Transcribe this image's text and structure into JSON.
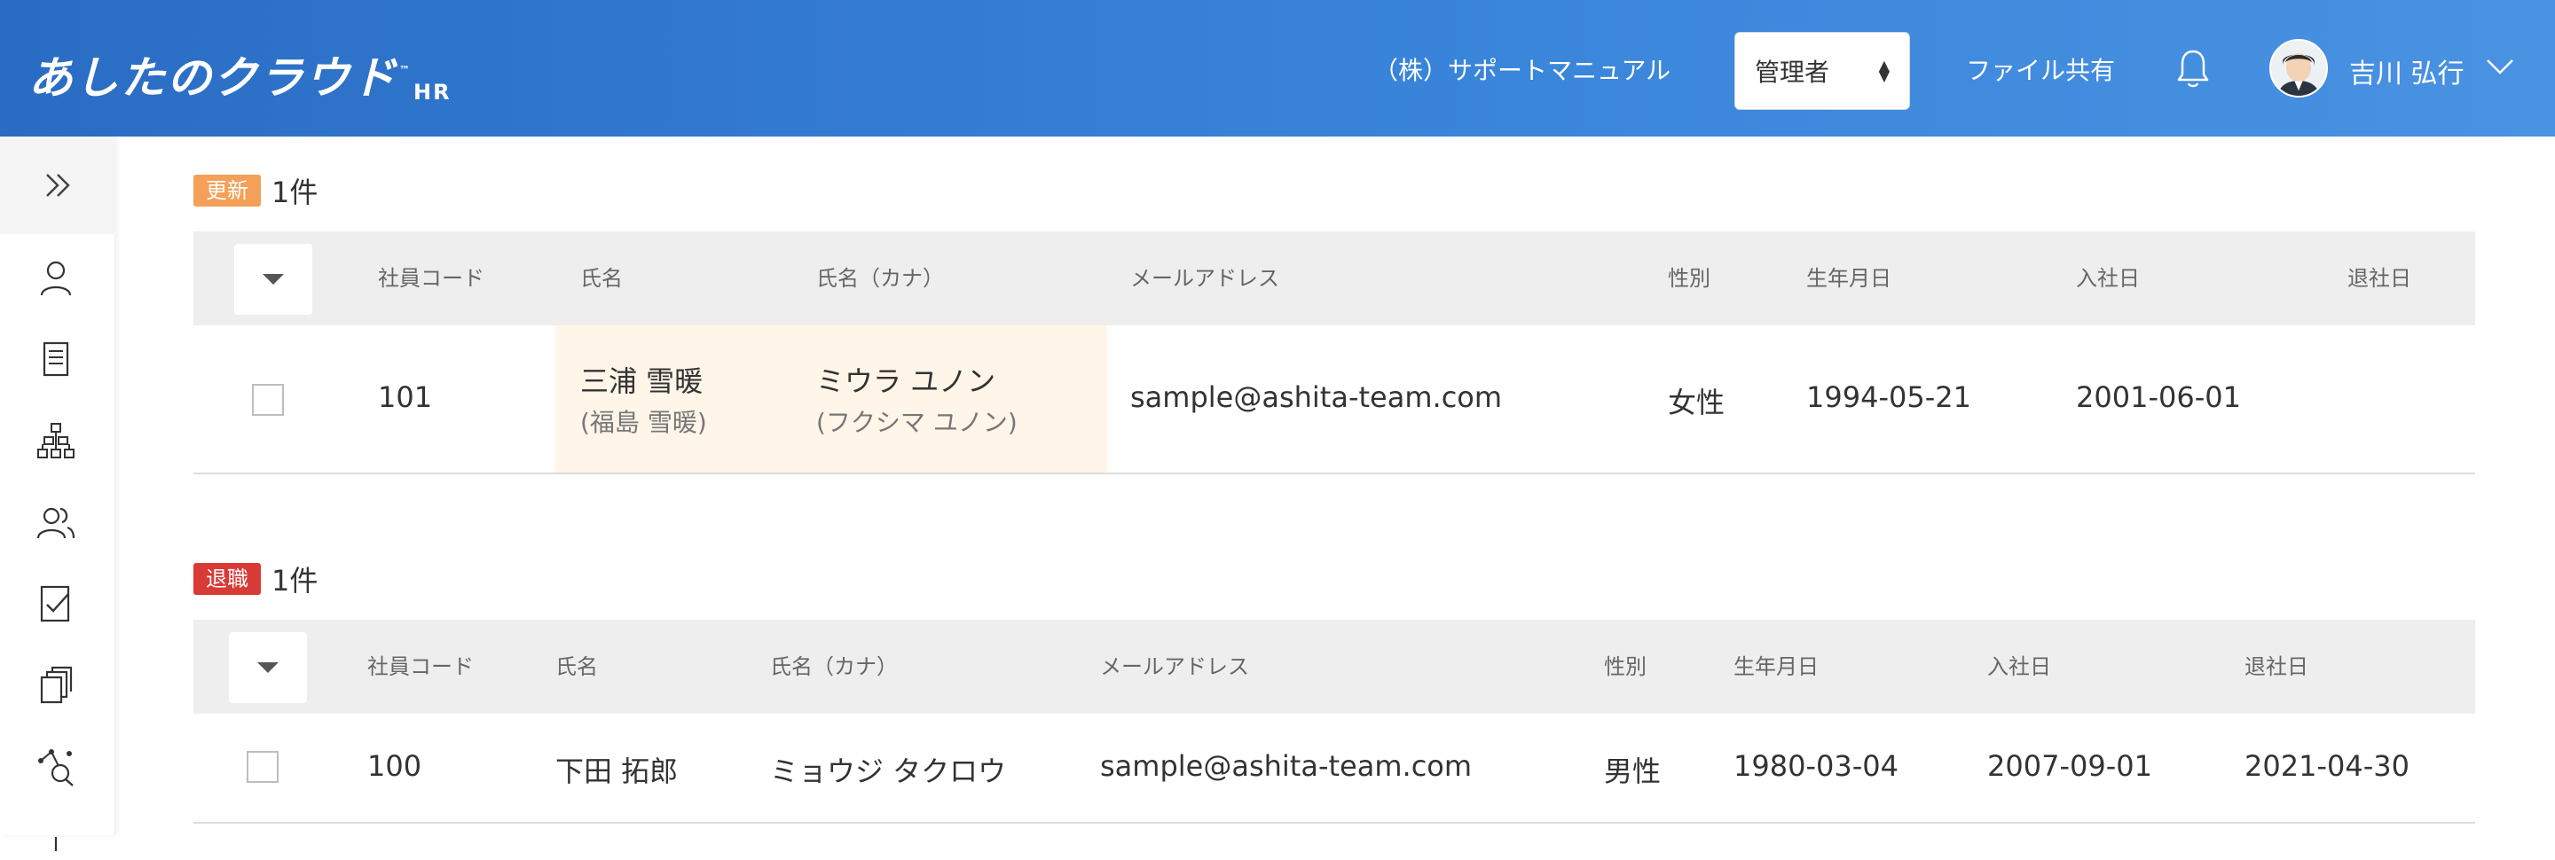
{
  "header": {
    "logo_text": "あしたのクラウド",
    "logo_tm": "™",
    "logo_suffix": "HR",
    "company": "（株）サポートマニュアル",
    "role_select": {
      "value": "管理者"
    },
    "file_share": "ファイル共有",
    "user_name": "吉川 弘行"
  },
  "sidebar": {
    "items": [
      {
        "icon": "person-icon"
      },
      {
        "icon": "document-icon"
      },
      {
        "icon": "org-chart-icon"
      },
      {
        "icon": "group-icon"
      },
      {
        "icon": "checklist-icon"
      },
      {
        "icon": "copy-icon"
      },
      {
        "icon": "analytics-search-icon"
      }
    ]
  },
  "colors": {
    "header_start": "#2a6cc4",
    "header_end": "#4a92e2",
    "update_badge": "#f4a058",
    "retire_badge": "#d83a36",
    "highlight": "#fff5e8"
  },
  "sections": {
    "update": {
      "badge": "更新",
      "count": "1件",
      "columns": [
        "社員コード",
        "氏名",
        "氏名（カナ）",
        "メールアドレス",
        "性別",
        "生年月日",
        "入社日",
        "退社日"
      ],
      "rows": [
        {
          "code": "101",
          "name": "三浦 雪暖",
          "name_prev": "(福島 雪暖)",
          "kana": "ミウラ ユノン",
          "kana_prev": "(フクシマ ユノン)",
          "email": "sample@ashita-team.com",
          "gender": "女性",
          "birth": "1994-05-21",
          "joined": "2001-06-01",
          "retired": ""
        }
      ]
    },
    "retire": {
      "badge": "退職",
      "count": "1件",
      "columns": [
        "社員コード",
        "氏名",
        "氏名（カナ）",
        "メールアドレス",
        "性別",
        "生年月日",
        "入社日",
        "退社日"
      ],
      "rows": [
        {
          "code": "100",
          "name": "下田 拓郎",
          "kana": "ミョウジ タクロウ",
          "email": "sample@ashita-team.com",
          "gender": "男性",
          "birth": "1980-03-04",
          "joined": "2007-09-01",
          "retired": "2021-04-30"
        }
      ]
    }
  }
}
